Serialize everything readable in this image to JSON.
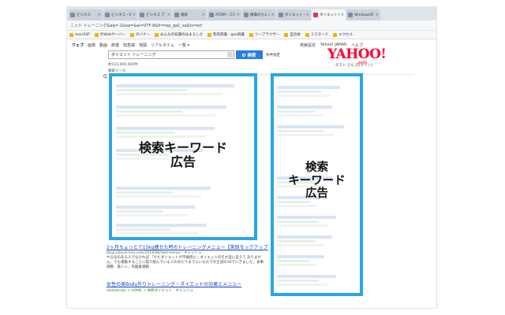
{
  "browser": {
    "tabs": [
      {
        "label": "ビジネス",
        "active": false
      },
      {
        "label": "ビジネス・Web",
        "active": false
      },
      {
        "label": "ビジネス アプリ",
        "active": false
      },
      {
        "label": "検索",
        "active": false
      },
      {
        "label": "ATOM・コスト",
        "active": false
      },
      {
        "label": "株価のカレンダー",
        "active": false
      },
      {
        "label": "ダイエット・サプリ",
        "active": false
      },
      {
        "label": "ダイエットトレー",
        "active": true
      },
      {
        "label": "Windowsのエクセ",
        "active": false
      }
    ],
    "address": "ニット トレーニング&aq=-1&oq=&ai=UTF-8&fr=top_ga1_sa&ts=ert",
    "bookmarks": [
      "moriASP",
      "のWebサーバー",
      "のバナー",
      "みんなの知識のはまるしか",
      "和英辞書 - goo辞書",
      "ツーブラウザー",
      "自治体",
      "ミスタード",
      "エクセル"
    ]
  },
  "yahoo": {
    "nav": [
      "ウェブ",
      "画像",
      "動画",
      "辞書",
      "知恵袋",
      "地図",
      "リアルタイム",
      "一覧 ▾"
    ],
    "right_links": [
      "検索設定",
      "Yahoo! JAPAN",
      "ヘルプ"
    ],
    "logo": "YAHOO!",
    "logo_sub": "JAPAN",
    "search_value": "ダイエット トレーニング",
    "search_button": "検索",
    "condition_link": "条件指定",
    "login": "ゲスト さん [ログイン]",
    "result_count": "約123,000,000件",
    "tools": "検索ツール",
    "left_marker": "Q"
  },
  "annotations": {
    "left_label": "検索キーワード\n広告",
    "right_label": "検索\nキーワード\n広告",
    "frame_color": "#27a7e7"
  },
  "results": [
    {
      "title": "2ヶ月ちょっとで15kg痩せた時のトレーニングメニュー【実践モックアップ",
      "url": "blog.sakura-mio.com/2018/06/diet-menu/ - キャッシュ",
      "description": "やる気のある人でなければ 「ただダイエットが不継続に」ダイエットのを大変に変えて ありません。でも運動することに取り組んでいる人のあたりまでにいなかでの王道の30でいきました。食事調整、筋トレ、有酸素運動"
    },
    {
      "title": "女性の美Body作りトレーニング・ダイエットの効果とメニュー",
      "url": "dietsite.biz > HOME > 体幹ダイエット - キャッシュ"
    }
  ]
}
